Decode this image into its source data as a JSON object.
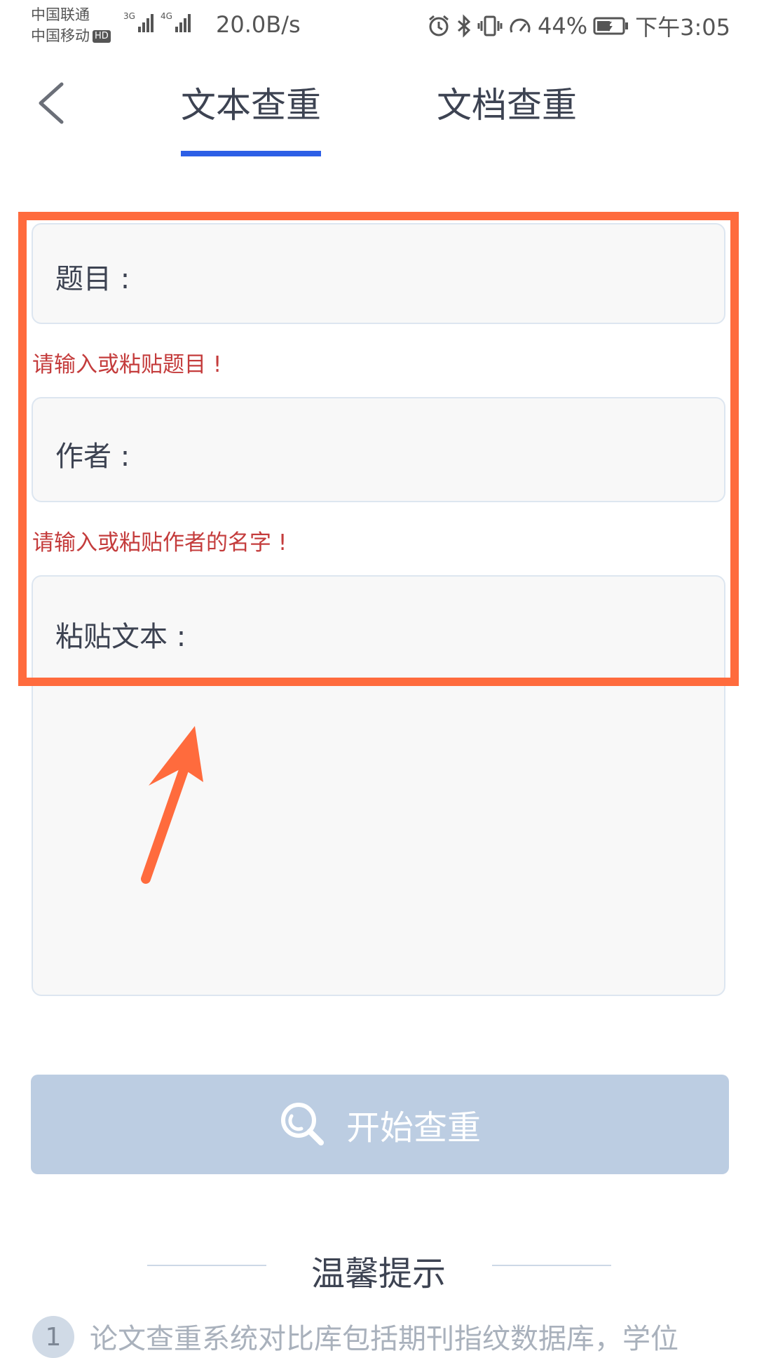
{
  "status_bar": {
    "carrier_1": "中国联通",
    "carrier_2": "中国移动",
    "hd_badge": "HD",
    "network_1": "3G",
    "network_2": "4G",
    "net_speed": "20.0B/s",
    "battery": "44%",
    "time": "下午3:05",
    "icons": [
      "alarm-icon",
      "bluetooth-icon",
      "vibrate-icon",
      "speed-icon",
      "battery-icon"
    ]
  },
  "header": {
    "tabs": [
      {
        "label": "文本查重",
        "active": true
      },
      {
        "label": "文档查重",
        "active": false
      }
    ]
  },
  "form": {
    "title_label": "题目 :",
    "title_error": "请输入或粘贴题目 !",
    "author_label": "作者 :",
    "author_error": "请输入或粘贴作者的名字 !",
    "text_label": "粘贴文本 :"
  },
  "start_button": {
    "label": "开始查重",
    "icon": "search-icon"
  },
  "tips": {
    "title": "温馨提示",
    "items": [
      {
        "number": "1",
        "text": "论文查重系统对比库包括期刊指纹数据库，学位"
      }
    ]
  },
  "colors": {
    "accent_blue": "#2d5fe6",
    "error_red": "#c43c3c",
    "annotation_orange": "#ff6b3d",
    "button_bg": "#bccde2"
  }
}
